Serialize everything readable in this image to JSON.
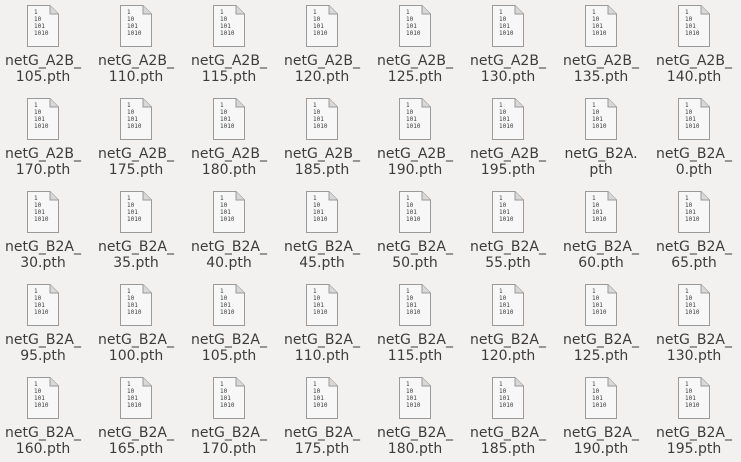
{
  "file_icon": {
    "icon": "binary-file-icon",
    "bits": [
      "1",
      "10",
      "101",
      "1010"
    ],
    "colors": {
      "paper": "#f7f7f7",
      "border": "#9a9a9a",
      "fold": "#d8d8d8"
    }
  },
  "files": [
    {
      "line1": "netG_A2B_",
      "line2": "105.pth"
    },
    {
      "line1": "netG_A2B_",
      "line2": "110.pth"
    },
    {
      "line1": "netG_A2B_",
      "line2": "115.pth"
    },
    {
      "line1": "netG_A2B_",
      "line2": "120.pth"
    },
    {
      "line1": "netG_A2B_",
      "line2": "125.pth"
    },
    {
      "line1": "netG_A2B_",
      "line2": "130.pth"
    },
    {
      "line1": "netG_A2B_",
      "line2": "135.pth"
    },
    {
      "line1": "netG_A2B_",
      "line2": "140.pth"
    },
    {
      "line1": "netG_A2B_",
      "line2": "170.pth"
    },
    {
      "line1": "netG_A2B_",
      "line2": "175.pth"
    },
    {
      "line1": "netG_A2B_",
      "line2": "180.pth"
    },
    {
      "line1": "netG_A2B_",
      "line2": "185.pth"
    },
    {
      "line1": "netG_A2B_",
      "line2": "190.pth"
    },
    {
      "line1": "netG_A2B_",
      "line2": "195.pth"
    },
    {
      "line1": "netG_B2A.",
      "line2": "pth"
    },
    {
      "line1": "netG_B2A_",
      "line2": "0.pth"
    },
    {
      "line1": "netG_B2A_",
      "line2": "30.pth"
    },
    {
      "line1": "netG_B2A_",
      "line2": "35.pth"
    },
    {
      "line1": "netG_B2A_",
      "line2": "40.pth"
    },
    {
      "line1": "netG_B2A_",
      "line2": "45.pth"
    },
    {
      "line1": "netG_B2A_",
      "line2": "50.pth"
    },
    {
      "line1": "netG_B2A_",
      "line2": "55.pth"
    },
    {
      "line1": "netG_B2A_",
      "line2": "60.pth"
    },
    {
      "line1": "netG_B2A_",
      "line2": "65.pth"
    },
    {
      "line1": "netG_B2A_",
      "line2": "95.pth"
    },
    {
      "line1": "netG_B2A_",
      "line2": "100.pth"
    },
    {
      "line1": "netG_B2A_",
      "line2": "105.pth"
    },
    {
      "line1": "netG_B2A_",
      "line2": "110.pth"
    },
    {
      "line1": "netG_B2A_",
      "line2": "115.pth"
    },
    {
      "line1": "netG_B2A_",
      "line2": "120.pth"
    },
    {
      "line1": "netG_B2A_",
      "line2": "125.pth"
    },
    {
      "line1": "netG_B2A_",
      "line2": "130.pth"
    },
    {
      "line1": "netG_B2A_",
      "line2": "160.pth"
    },
    {
      "line1": "netG_B2A_",
      "line2": "165.pth"
    },
    {
      "line1": "netG_B2A_",
      "line2": "170.pth"
    },
    {
      "line1": "netG_B2A_",
      "line2": "175.pth"
    },
    {
      "line1": "netG_B2A_",
      "line2": "180.pth"
    },
    {
      "line1": "netG_B2A_",
      "line2": "185.pth"
    },
    {
      "line1": "netG_B2A_",
      "line2": "190.pth"
    },
    {
      "line1": "netG_B2A_",
      "line2": "195.pth"
    }
  ]
}
